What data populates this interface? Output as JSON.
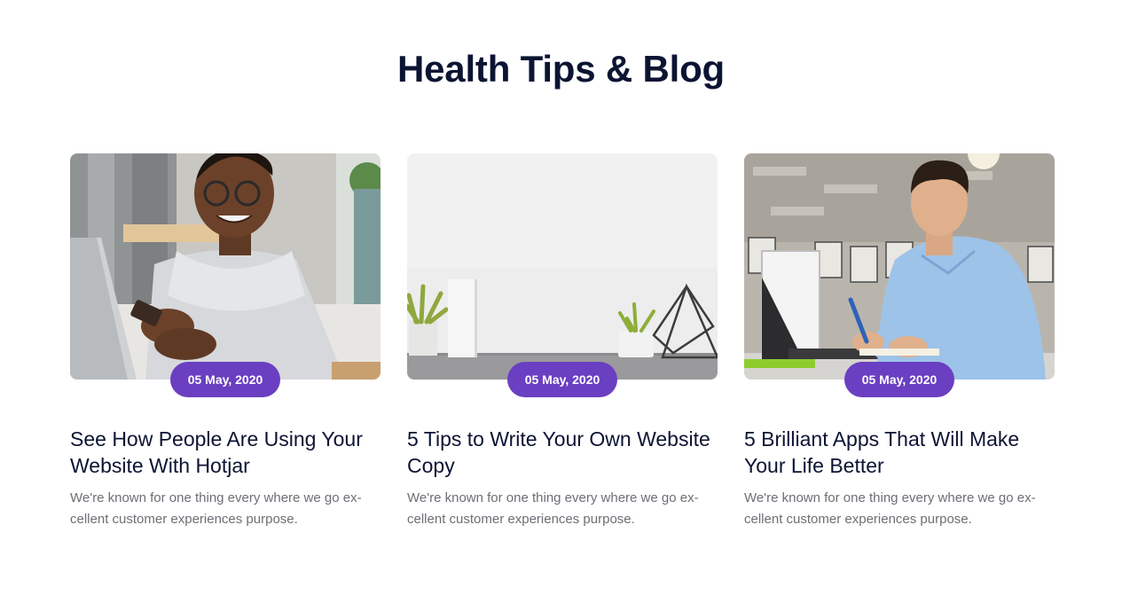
{
  "section": {
    "title": "Health Tips & Blog"
  },
  "posts": [
    {
      "date": "05 May, 2020",
      "title": "See How People Are Using Your Website With Hotjar",
      "excerpt": "We're known for one thing every where we go ex-cellent customer experiences purpose.",
      "image": "woman-with-phone-photo"
    },
    {
      "date": "05 May, 2020",
      "title": "5 Tips to Write Your Own Website Copy",
      "excerpt": "We're known for one thing every where we go ex-cellent customer experiences purpose.",
      "image": "desk-plants-photo"
    },
    {
      "date": "05 May, 2020",
      "title": "5 Brilliant Apps That Will Make Your Life Better",
      "excerpt": "We're known for one thing every where we go ex-cellent customer experiences purpose.",
      "image": "man-writing-photo"
    }
  ],
  "colors": {
    "accent": "#6a3fc1",
    "heading": "#0c1433",
    "body_text": "#6e6e76"
  }
}
